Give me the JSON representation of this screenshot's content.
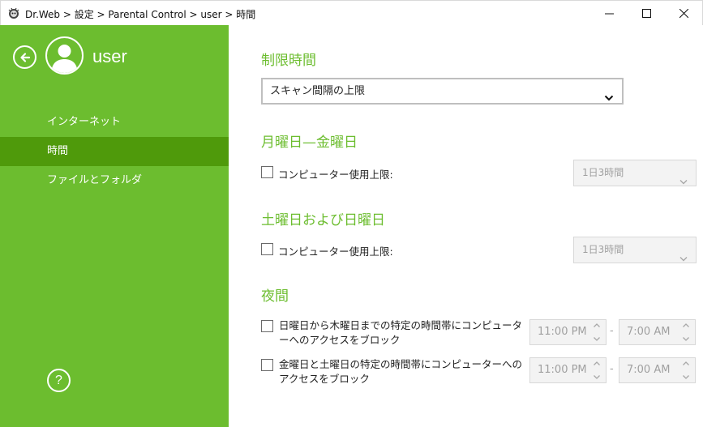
{
  "window": {
    "title": "Dr.Web > 設定 > Parental Control > user > 時間"
  },
  "sidebar": {
    "user_name": "user",
    "items": [
      {
        "label": "インターネット"
      },
      {
        "label": "時間"
      },
      {
        "label": "ファイルとフォルダ"
      }
    ],
    "help_label": "?"
  },
  "main": {
    "limit_title": "制限時間",
    "limit_mode": "スキャン間隔の上限",
    "weekdays": {
      "title": "月曜日—金曜日",
      "checkbox_label": "コンピューター使用上限:",
      "limit_value": "1日3時間"
    },
    "weekend": {
      "title": "土曜日および日曜日",
      "checkbox_label": "コンピューター使用上限:",
      "limit_value": "1日3時間"
    },
    "night": {
      "title": "夜間",
      "rule1_label": "日曜日から木曜日までの特定の時間帯にコンピューターへのアクセスをブロック",
      "rule1_from": "11:00 PM",
      "rule1_to": "7:00 AM",
      "rule2_label": "金曜日と土曜日の特定の時間帯にコンピューターへのアクセスをブロック",
      "rule2_from": "11:00 PM",
      "rule2_to": "7:00 AM",
      "range_sep": "-"
    }
  },
  "colors": {
    "accent": "#6cbd2f",
    "sidebar_active": "#4f9a0b"
  }
}
